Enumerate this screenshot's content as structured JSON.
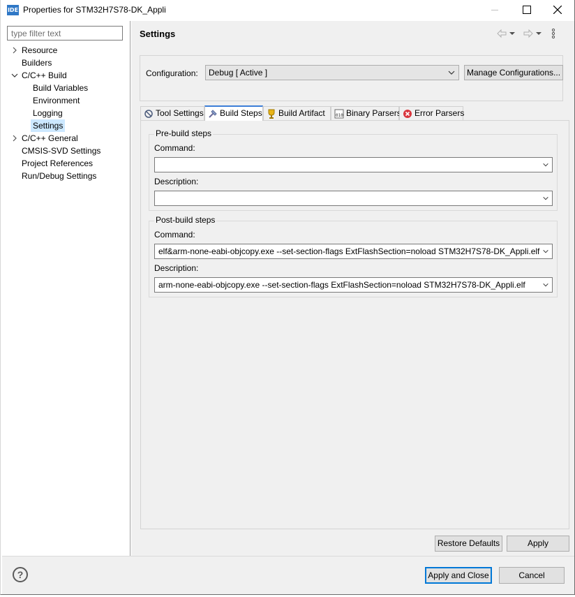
{
  "window": {
    "icon_text": "IDE",
    "title": "Properties for STM32H7S78-DK_Appli"
  },
  "left": {
    "filter_placeholder": "type filter text",
    "tree": [
      {
        "label": "Resource",
        "expandable": true,
        "expanded": false
      },
      {
        "label": "Builders",
        "expandable": false
      },
      {
        "label": "C/C++ Build",
        "expandable": true,
        "expanded": true
      },
      {
        "label": "Build Variables",
        "expandable": false
      },
      {
        "label": "Environment",
        "expandable": false
      },
      {
        "label": "Logging",
        "expandable": false
      },
      {
        "label": "Settings",
        "expandable": false,
        "selected": true
      },
      {
        "label": "C/C++ General",
        "expandable": true,
        "expanded": false
      },
      {
        "label": "CMSIS-SVD Settings",
        "expandable": false
      },
      {
        "label": "Project References",
        "expandable": false
      },
      {
        "label": "Run/Debug Settings",
        "expandable": false
      }
    ]
  },
  "right": {
    "title": "Settings",
    "config_label": "Configuration:",
    "config_value": "Debug  [ Active ]",
    "manage_label": "Manage Configurations...",
    "tabs": [
      {
        "label": "Tool Settings",
        "icon": "tool-settings-icon"
      },
      {
        "label": "Build Steps",
        "icon": "build-steps-icon",
        "active": true
      },
      {
        "label": "Build Artifact",
        "icon": "trophy-icon"
      },
      {
        "label": "Binary Parsers",
        "icon": "binary-parser-icon"
      },
      {
        "label": "Error Parsers",
        "icon": "error-icon"
      }
    ],
    "pre_build": {
      "title": "Pre-build steps",
      "command_label": "Command:",
      "command_value": "",
      "description_label": "Description:",
      "description_value": ""
    },
    "post_build": {
      "title": "Post-build steps",
      "command_label": "Command:",
      "command_value": "elf&arm-none-eabi-objcopy.exe --set-section-flags ExtFlashSection=noload STM32H7S78-DK_Appli.elf",
      "description_label": "Description:",
      "description_value": "arm-none-eabi-objcopy.exe --set-section-flags ExtFlashSection=noload STM32H7S78-DK_Appli.elf"
    },
    "restore_label": "Restore Defaults",
    "apply_label": "Apply"
  },
  "bottom": {
    "help_glyph": "?",
    "apply_close_label": "Apply and Close",
    "cancel_label": "Cancel"
  }
}
